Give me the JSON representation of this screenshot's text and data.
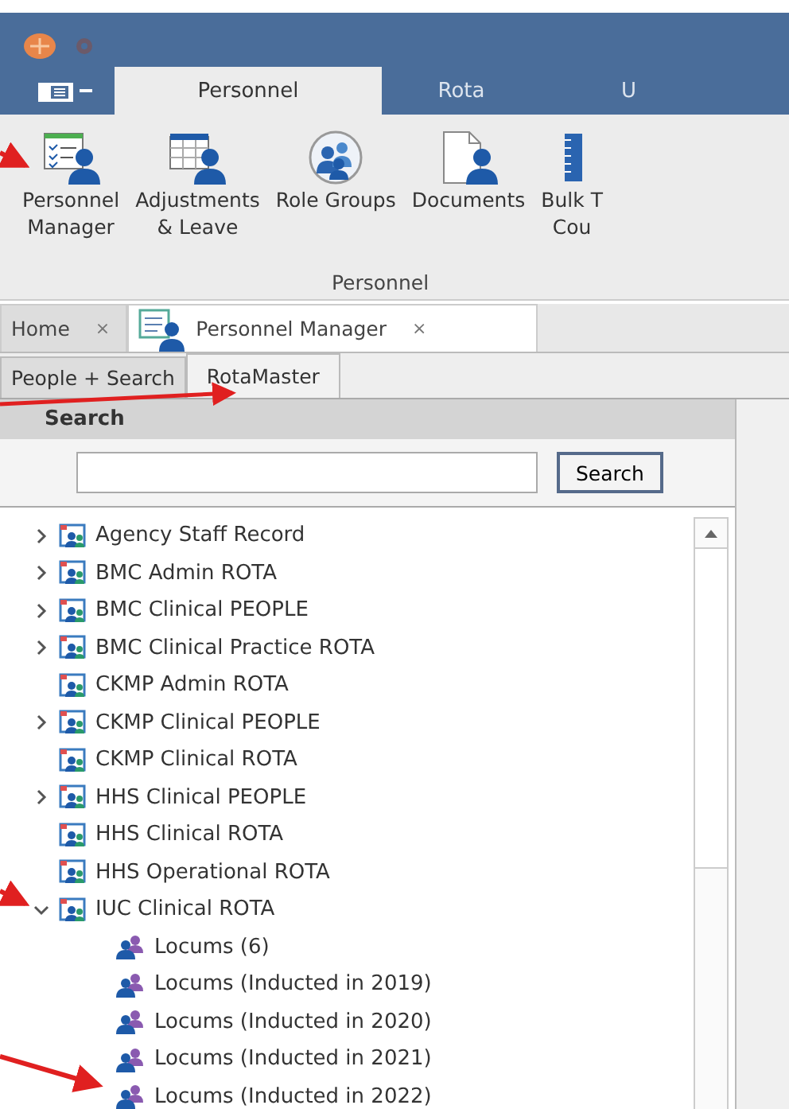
{
  "ribbon_tabs": [
    {
      "label": "Personnel",
      "selected": true
    },
    {
      "label": "Rota",
      "selected": false
    },
    {
      "label": "U",
      "selected": false
    }
  ],
  "ribbon_buttons": [
    {
      "lines": [
        "Personnel",
        "Manager"
      ],
      "kind": "checklist"
    },
    {
      "lines": [
        "Adjustments",
        "& Leave"
      ],
      "kind": "calendar"
    },
    {
      "lines": [
        "Role Groups"
      ],
      "kind": "group"
    },
    {
      "lines": [
        "Documents"
      ],
      "kind": "document"
    },
    {
      "lines": [
        "Bulk T",
        "Cou"
      ],
      "kind": "binder"
    }
  ],
  "ribbon_group": "Personnel",
  "document_tabs": [
    {
      "label": "Home",
      "close": "×",
      "selected": false,
      "icon": false
    },
    {
      "label": "Personnel Manager",
      "close": "×",
      "selected": true,
      "icon": true
    }
  ],
  "sub_tabs": [
    {
      "label": "People + Search",
      "selected": false
    },
    {
      "label": "RotaMaster",
      "selected": true
    }
  ],
  "search": {
    "header": "Search",
    "button": "Search"
  },
  "tree": [
    {
      "label": "Agency Staff Record",
      "expanded": false
    },
    {
      "label": "BMC Admin ROTA",
      "expanded": false
    },
    {
      "label": "BMC Clinical PEOPLE",
      "expanded": false
    },
    {
      "label": "BMC Clinical Practice ROTA",
      "expanded": false
    },
    {
      "label": "CKMP Admin ROTA"
    },
    {
      "label": "CKMP Clinical PEOPLE",
      "expanded": false
    },
    {
      "label": "CKMP Clinical ROTA"
    },
    {
      "label": "HHS Clinical PEOPLE",
      "expanded": false
    },
    {
      "label": "HHS Clinical ROTA"
    },
    {
      "label": "HHS Operational ROTA"
    },
    {
      "label": "IUC Clinical ROTA",
      "expanded": true,
      "children": [
        {
          "label": "Locums (6)"
        },
        {
          "label": "Locums (Inducted in 2019)"
        },
        {
          "label": "Locums (Inducted in 2020)"
        },
        {
          "label": "Locums (Inducted in 2021)"
        },
        {
          "label": "Locums (Inducted in 2022)"
        }
      ]
    }
  ]
}
